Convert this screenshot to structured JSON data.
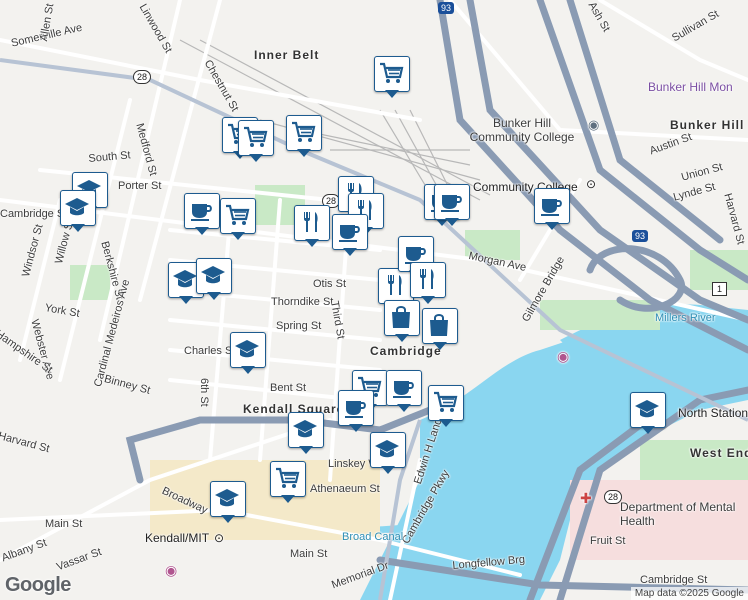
{
  "map": {
    "colors": {
      "background": "#f3f2ef",
      "water": "#8ad6f0",
      "park": "#c9e9c6",
      "highway": "#8a9bb3",
      "road": "#ffffff",
      "campus": "#f4e9c9",
      "marker_border": "#1d5b8f"
    },
    "street_labels": [
      "Somerville Ave",
      "Linwood St",
      "Allen St",
      "Chestnut St",
      "Inner Belt",
      "Medford St",
      "South St",
      "Porter St",
      "Cambridge St",
      "Windsor St",
      "Willow St",
      "Berkshire St",
      "Cardinal Medeiros Ave",
      "York St",
      "Webster Ave",
      "Hampshire St",
      "Harvard St",
      "Binney St",
      "Charles St",
      "Spring St",
      "Thorndike St",
      "Otis St",
      "Third St",
      "Morgan Ave",
      "Gilmore Bridge",
      "Bent St",
      "6th St",
      "Kendall Square",
      "Linskey Way",
      "Athenaeum St",
      "Edwin H Land Blvd",
      "Cambridge Pkwy",
      "Broadway",
      "Main St",
      "Kendall/MIT",
      "Albany St",
      "Vassar St",
      "Main St",
      "Broad Canal",
      "Longfellow Brg",
      "Memorial Dr",
      "Cambridge St",
      "Fruit St",
      "North Station",
      "West End",
      "Millers River",
      "Community College",
      "Bunker Hill",
      "Bunker Hill Community College",
      "Bunker Hill Mon",
      "Austin St",
      "Union St",
      "Lynde St",
      "Sullivan St",
      "Harvard St",
      "Cambridge",
      "Department of Mental Health",
      "Ash St",
      "93",
      "93",
      "1",
      "28",
      "28",
      "28"
    ],
    "markers": [
      {
        "type": "grocery",
        "icon": "shopping-cart-icon"
      },
      {
        "type": "grocery",
        "icon": "shopping-cart-icon"
      },
      {
        "type": "grocery",
        "icon": "shopping-cart-icon"
      },
      {
        "type": "grocery",
        "icon": "shopping-cart-icon"
      },
      {
        "type": "school",
        "icon": "graduation-cap-icon"
      },
      {
        "type": "school",
        "icon": "graduation-cap-icon"
      },
      {
        "type": "cafe",
        "icon": "coffee-cup-icon"
      },
      {
        "type": "grocery",
        "icon": "shopping-cart-icon"
      },
      {
        "type": "restaurant",
        "icon": "fork-knife-icon"
      },
      {
        "type": "restaurant",
        "icon": "fork-knife-icon"
      },
      {
        "type": "restaurant",
        "icon": "fork-knife-icon"
      },
      {
        "type": "cafe",
        "icon": "coffee-cup-icon"
      },
      {
        "type": "cafe",
        "icon": "coffee-cup-icon"
      },
      {
        "type": "cafe",
        "icon": "coffee-cup-icon"
      },
      {
        "type": "cafe",
        "icon": "coffee-cup-icon"
      },
      {
        "type": "restaurant",
        "icon": "fork-knife-icon"
      },
      {
        "type": "school",
        "icon": "graduation-cap-icon"
      },
      {
        "type": "school",
        "icon": "graduation-cap-icon"
      },
      {
        "type": "cafe",
        "icon": "coffee-cup-icon"
      },
      {
        "type": "restaurant",
        "icon": "fork-knife-icon"
      },
      {
        "type": "shopping",
        "icon": "shopping-bag-icon"
      },
      {
        "type": "shopping",
        "icon": "shopping-bag-icon"
      },
      {
        "type": "school",
        "icon": "graduation-cap-icon"
      },
      {
        "type": "grocery",
        "icon": "shopping-cart-icon"
      },
      {
        "type": "cafe",
        "icon": "coffee-cup-icon"
      },
      {
        "type": "cafe",
        "icon": "coffee-cup-icon"
      },
      {
        "type": "grocery",
        "icon": "shopping-cart-icon"
      },
      {
        "type": "school",
        "icon": "graduation-cap-icon"
      },
      {
        "type": "school",
        "icon": "graduation-cap-icon"
      },
      {
        "type": "grocery",
        "icon": "shopping-cart-icon"
      },
      {
        "type": "school",
        "icon": "graduation-cap-icon"
      },
      {
        "type": "school",
        "icon": "graduation-cap-icon"
      }
    ],
    "attribution": "Map data ©2025 Google",
    "logo": "Google"
  }
}
